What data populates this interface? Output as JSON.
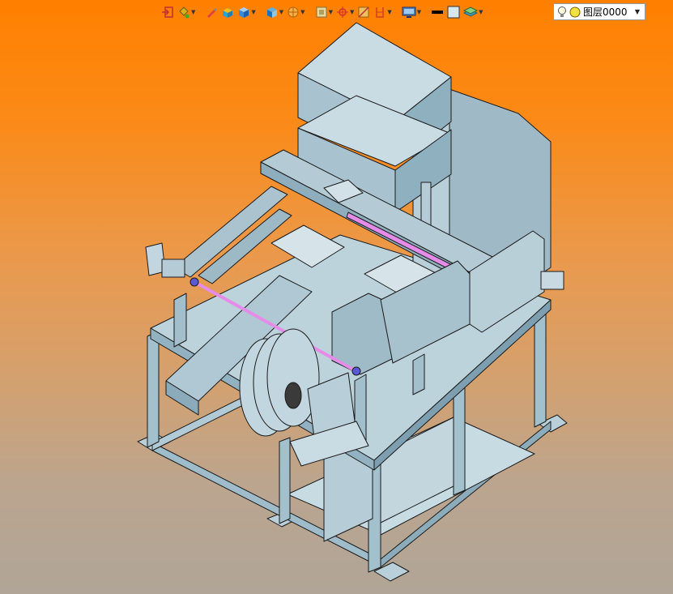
{
  "toolbar": {
    "tools": [
      {
        "icon": "exit-sketch-icon",
        "dropdown": false
      },
      {
        "icon": "paint-bucket-icon",
        "dropdown": true
      },
      {
        "icon": "pencil-icon",
        "dropdown": false
      },
      {
        "icon": "part-color-icon",
        "dropdown": false
      },
      {
        "icon": "shaded-cube-icon",
        "dropdown": true
      },
      {
        "icon": "view-orientation-icon",
        "dropdown": true
      },
      {
        "icon": "render-style-icon",
        "dropdown": true
      },
      {
        "icon": "zoom-window-icon",
        "dropdown": true
      },
      {
        "icon": "snap-point-icon",
        "dropdown": true
      },
      {
        "icon": "section-view-icon",
        "dropdown": false
      },
      {
        "icon": "clip-plane-icon",
        "dropdown": true
      },
      {
        "icon": "display-settings-icon",
        "dropdown": true
      },
      {
        "icon": "line-style-icon",
        "dropdown": false
      },
      {
        "icon": "color-swatch-icon",
        "dropdown": false
      },
      {
        "icon": "layer-stack-icon",
        "dropdown": true
      }
    ]
  },
  "layer_select": {
    "value": "图层0000",
    "icons": [
      "lightbulb-icon",
      "layer-color-dot-icon"
    ]
  },
  "colors": {
    "background_top": "#ff8000",
    "background_bottom": "#b0a597",
    "model_face": "#a9c4d0",
    "model_edge": "#1a1a1a",
    "highlight": "#e58ce8",
    "accent_blue": "#5a5ad8"
  }
}
